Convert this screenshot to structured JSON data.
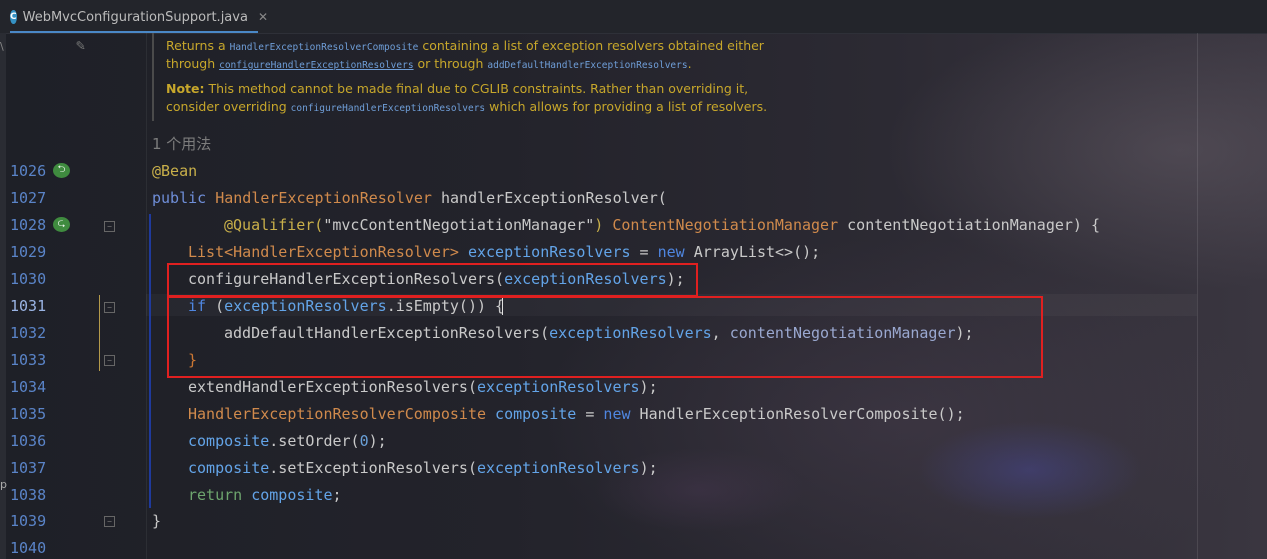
{
  "tab": {
    "icon_letter": "C",
    "filename": "WebMvcConfigurationSupport.java",
    "close_glyph": "✕"
  },
  "doc": {
    "line1_a": "Returns a ",
    "line1_code": "HandlerExceptionResolverComposite",
    "line1_b": " containing a list of exception resolvers obtained either",
    "line2_a": "through ",
    "line2_link1": "configureHandlerExceptionResolvers",
    "line2_b": " or through ",
    "line2_code": "addDefaultHandlerExceptionResolvers",
    "line2_c": ".",
    "line3_note": "Note:",
    "line3_rest": " This method cannot be made final due to CGLIB constraints. Rather than overriding it,",
    "line4_a": "consider overriding ",
    "line4_code": "configureHandlerExceptionResolvers",
    "line4_b": " which allows for providing a list of resolvers."
  },
  "usages": "1 个用法",
  "line_numbers": [
    "1026",
    "1027",
    "1028",
    "1029",
    "1030",
    "1031",
    "1032",
    "1033",
    "1034",
    "1035",
    "1036",
    "1037",
    "1038",
    "1039",
    "1040"
  ],
  "code": {
    "l1026": "@Bean",
    "l1027_kw": "public",
    "l1027_type": "HandlerExceptionResolver",
    "l1027_name": " handlerExceptionResolver(",
    "l1028_ann": "@Qualifier(",
    "l1028_str": "\"mvcContentNegotiationManager\"",
    "l1028_close": ")",
    "l1028_type": "ContentNegotiationManager",
    "l1028_param": " contentNegotiationManager) {",
    "l1029_a": "List<",
    "l1029_type": "HandlerExceptionResolver",
    "l1029_b": "> ",
    "l1029_var": "exceptionResolvers",
    "l1029_c": " = ",
    "l1029_new": "new",
    "l1029_d": " ArrayList<>();",
    "l1030_a": "configureHandlerExceptionResolvers(",
    "l1030_var": "exceptionResolvers",
    "l1030_b": ");",
    "l1031_if": "if",
    "l1031_a": " (",
    "l1031_var": "exceptionResolvers",
    "l1031_b": ".isEmpty()) {",
    "l1032_a": "addDefaultHandlerExceptionResolvers(",
    "l1032_var": "exceptionResolvers",
    "l1032_b": ", ",
    "l1032_param": "contentNegotiationManager",
    "l1032_c": ");",
    "l1033": "}",
    "l1034_a": "extendHandlerExceptionResolvers(",
    "l1034_var": "exceptionResolvers",
    "l1034_b": ");",
    "l1035_type": "HandlerExceptionResolverComposite",
    "l1035_var": " composite",
    "l1035_a": " = ",
    "l1035_new": "new",
    "l1035_b": " HandlerExceptionResolverComposite();",
    "l1036_var": "composite",
    "l1036_a": ".setOrder(",
    "l1036_num": "0",
    "l1036_b": ");",
    "l1037_var": "composite",
    "l1037_a": ".setExceptionResolvers(",
    "l1037_var2": "exceptionResolvers",
    "l1037_b": ");",
    "l1038_ret": "return",
    "l1038_var": " composite",
    "l1038_b": ";",
    "l1039": "}"
  },
  "colors": {
    "line_number": "#5a84c8",
    "keyword": "#6f8ed8",
    "annotation": "#c9b04a",
    "type": "#d08a4c",
    "variable": "#63a4e8",
    "highlight_box": "#e02020"
  },
  "icons": {
    "override": "override-arrow-icon",
    "edit": "pencil-icon",
    "file": "java-class-icon"
  }
}
